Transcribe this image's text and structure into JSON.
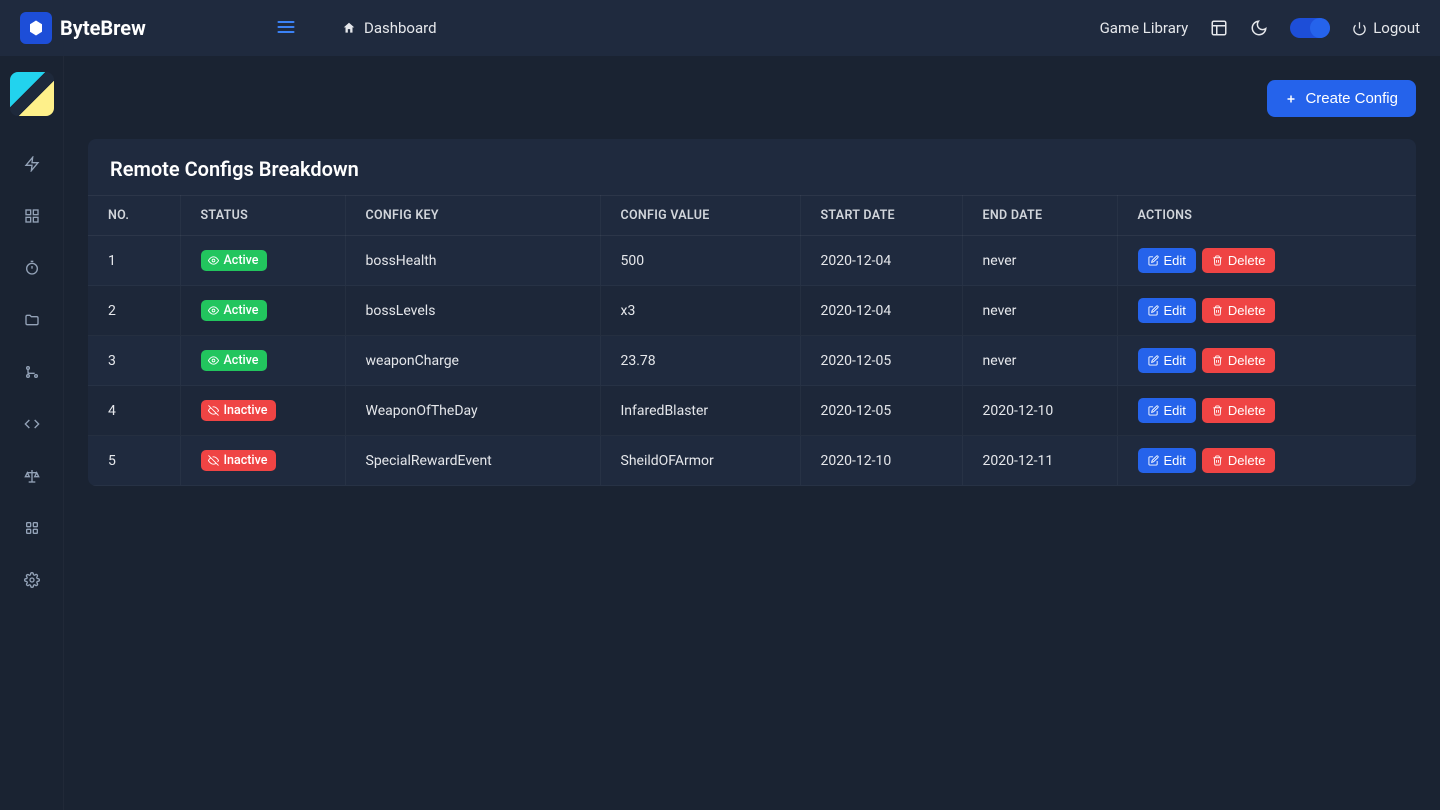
{
  "brand": "ByteBrew",
  "header": {
    "dashboard_label": "Dashboard",
    "game_library_label": "Game Library",
    "logout_label": "Logout"
  },
  "action_bar": {
    "create_config_label": "Create Config"
  },
  "panel": {
    "title": "Remote Configs Breakdown"
  },
  "table": {
    "columns": {
      "no": "NO.",
      "status": "STATUS",
      "config_key": "CONFIG KEY",
      "config_value": "CONFIG VALUE",
      "start_date": "START DATE",
      "end_date": "END DATE",
      "actions": "ACTIONS"
    },
    "status_labels": {
      "active": "Active",
      "inactive": "Inactive"
    },
    "action_labels": {
      "edit": "Edit",
      "delete": "Delete"
    },
    "rows": [
      {
        "no": "1",
        "status": "active",
        "key": "bossHealth",
        "value": "500",
        "start": "2020-12-04",
        "end": "never"
      },
      {
        "no": "2",
        "status": "active",
        "key": "bossLevels",
        "value": "x3",
        "start": "2020-12-04",
        "end": "never"
      },
      {
        "no": "3",
        "status": "active",
        "key": "weaponCharge",
        "value": "23.78",
        "start": "2020-12-05",
        "end": "never"
      },
      {
        "no": "4",
        "status": "inactive",
        "key": "WeaponOfTheDay",
        "value": "InfaredBlaster",
        "start": "2020-12-05",
        "end": "2020-12-10"
      },
      {
        "no": "5",
        "status": "inactive",
        "key": "SpecialRewardEvent",
        "value": "SheildOFArmor",
        "start": "2020-12-10",
        "end": "2020-12-11"
      }
    ]
  }
}
